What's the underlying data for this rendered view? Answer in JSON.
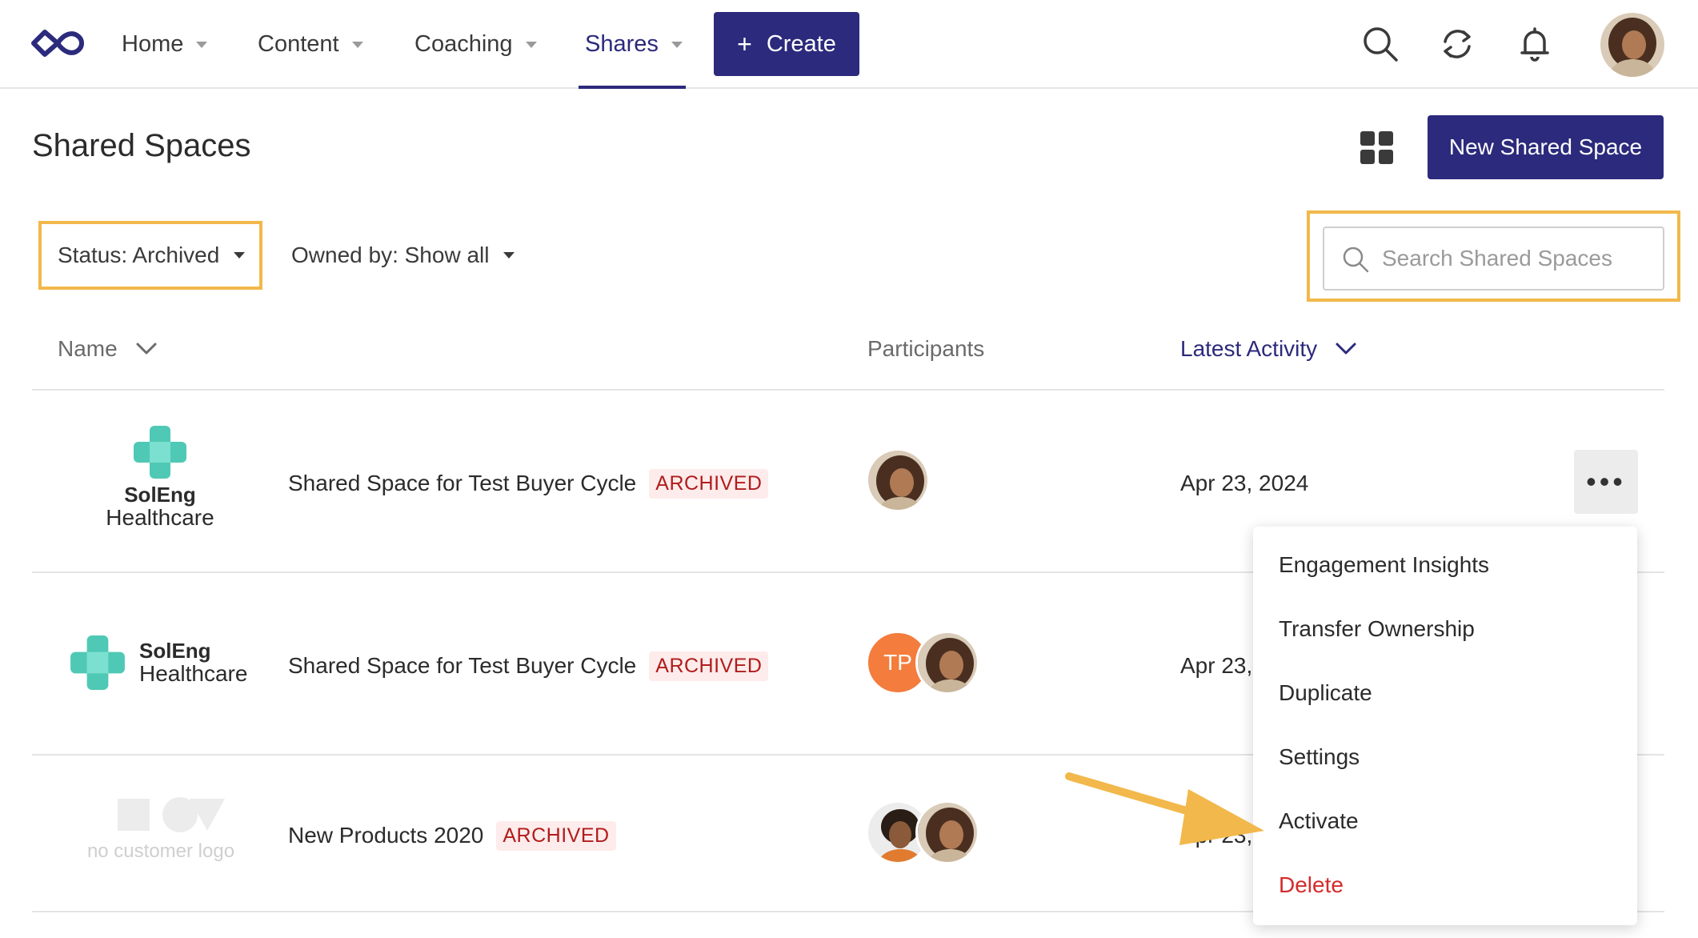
{
  "nav": {
    "items": [
      {
        "label": "Home"
      },
      {
        "label": "Content"
      },
      {
        "label": "Coaching"
      },
      {
        "label": "Shares"
      }
    ],
    "active": "Shares",
    "create_label": "Create"
  },
  "page": {
    "title": "Shared Spaces",
    "new_button_label": "New Shared Space"
  },
  "filters": {
    "status_label": "Status: Archived",
    "owner_label": "Owned by: Show all",
    "search_placeholder": "Search Shared Spaces",
    "search_value": ""
  },
  "table": {
    "columns": {
      "name": "Name",
      "participants": "Participants",
      "latest_activity": "Latest Activity"
    },
    "rows": [
      {
        "logo_bold": "SolEng",
        "logo_normal": "Healthcare",
        "name": "Shared Space for Test Buyer Cycle",
        "status": "ARCHIVED",
        "date": "Apr 23, 2024"
      },
      {
        "logo_bold": "SolEng",
        "logo_normal": "Healthcare",
        "name": "Shared Space for Test Buyer Cycle",
        "status": "ARCHIVED",
        "participant_initials": "TP",
        "date": "Apr 23,"
      },
      {
        "logo_placeholder": "no customer logo",
        "name": "New Products 2020",
        "status": "ARCHIVED",
        "date": "Apr 23,"
      }
    ]
  },
  "row_menu": {
    "items": [
      {
        "label": "Engagement Insights"
      },
      {
        "label": "Transfer Ownership"
      },
      {
        "label": "Duplicate"
      },
      {
        "label": "Settings"
      },
      {
        "label": "Activate"
      },
      {
        "label": "Delete"
      }
    ]
  },
  "colors": {
    "brand": "#2c2a7c",
    "highlight": "#f2b84b",
    "archived_text": "#b11c1c",
    "danger": "#d42b2b",
    "logo_teal": "#4fc9b5",
    "initials_avatar": "#f47c3c"
  }
}
